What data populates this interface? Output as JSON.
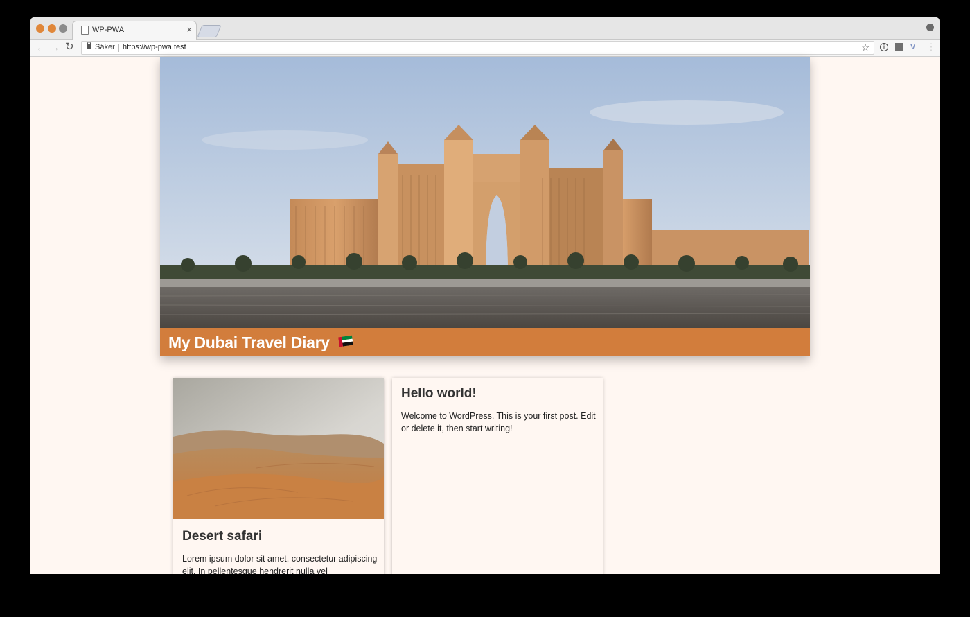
{
  "browser": {
    "tab_title": "WP-PWA",
    "tab_close": "×",
    "security_label": "Säker",
    "url": "https://wp-pwa.test",
    "back_icon": "←",
    "forward_icon": "→",
    "reload_icon": "↻",
    "star_icon": "☆",
    "menu_icon": "⋮",
    "ext_info": "i",
    "ext_vpn": "V"
  },
  "site": {
    "title": "My Dubai Travel Diary",
    "accent_color": "#d27d3c",
    "background_color": "#fff7f2"
  },
  "posts": [
    {
      "title": "Desert safari",
      "excerpt": "Lorem ipsum dolor sit amet, consectetur adipiscing elit. In pellentesque hendrerit nulla vel"
    },
    {
      "title": "Hello world!",
      "excerpt": "Welcome to WordPress. This is your first post. Edit or delete it, then start writing!"
    }
  ]
}
